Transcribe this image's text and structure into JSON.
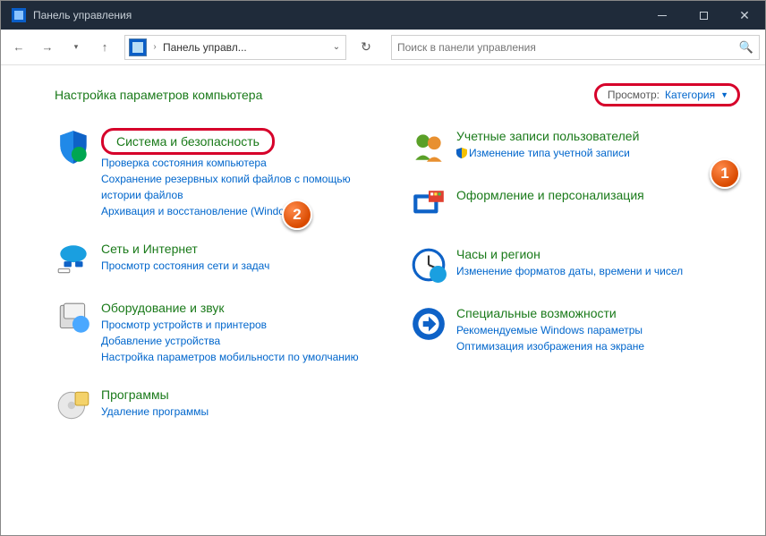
{
  "window": {
    "title": "Панель управления"
  },
  "toolbar": {
    "breadcrumb": "Панель управл...",
    "search_placeholder": "Поиск в панели управления"
  },
  "page": {
    "title": "Настройка параметров компьютера",
    "view_label": "Просмотр:",
    "view_value": "Категория"
  },
  "left": [
    {
      "title": "Система и безопасность",
      "highlight": true,
      "links": [
        "Проверка состояния компьютера",
        "Сохранение резервных копий файлов с помощью истории файлов",
        "Архивация и восстановление (Windows 7)"
      ]
    },
    {
      "title": "Сеть и Интернет",
      "links": [
        "Просмотр состояния сети и задач"
      ]
    },
    {
      "title": "Оборудование и звук",
      "links": [
        "Просмотр устройств и принтеров",
        "Добавление устройства",
        "Настройка параметров мобильности по умолчанию"
      ]
    },
    {
      "title": "Программы",
      "links": [
        "Удаление программы"
      ]
    }
  ],
  "right": [
    {
      "title": "Учетные записи пользователей",
      "links": [
        {
          "shield": true,
          "text": "Изменение типа учетной записи"
        }
      ]
    },
    {
      "title": "Оформление и персонализация",
      "links": []
    },
    {
      "title": "Часы и регион",
      "links": [
        "Изменение форматов даты, времени и чисел"
      ]
    },
    {
      "title": "Специальные возможности",
      "links": [
        "Рекомендуемые Windows параметры",
        "Оптимизация изображения на экране"
      ]
    }
  ],
  "annotations": {
    "b1": "1",
    "b2": "2"
  }
}
